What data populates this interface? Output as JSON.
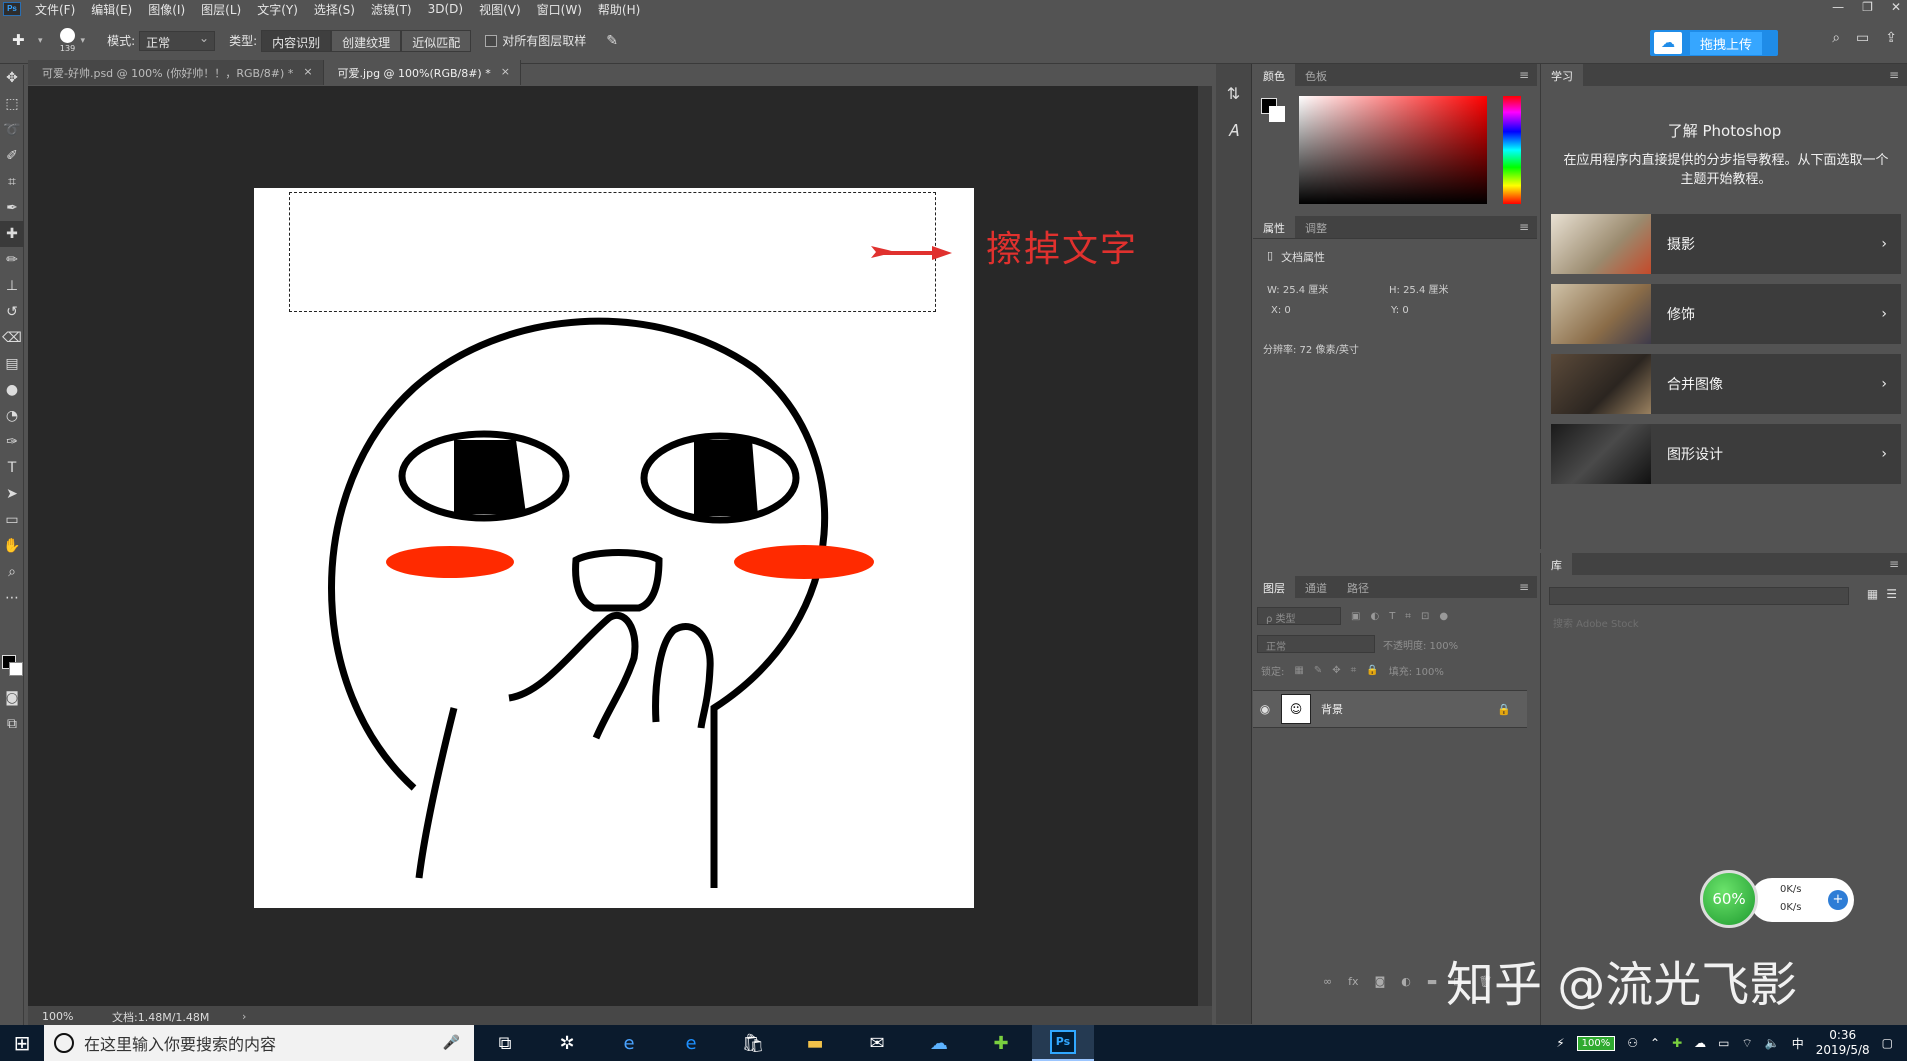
{
  "menubar": {
    "logo": "Ps",
    "items": [
      "文件(F)",
      "编辑(E)",
      "图像(I)",
      "图层(L)",
      "文字(Y)",
      "选择(S)",
      "滤镜(T)",
      "3D(D)",
      "视图(V)",
      "窗口(W)",
      "帮助(H)"
    ],
    "win_min": "—",
    "win_restore": "❐",
    "win_close": "✕"
  },
  "options": {
    "brush_size": "139",
    "mode_label": "模式:",
    "mode_value": "正常",
    "type_label": "类型:",
    "type_options": [
      "内容识别",
      "创建纹理",
      "近似匹配"
    ],
    "sample_all_label": "对所有图层取样",
    "upload_label": "拖拽上传"
  },
  "tabs": [
    {
      "label": "可爱-好帅.psd @ 100% (你好帅！！，RGB/8#) *"
    },
    {
      "label": "可爱.jpg @ 100%(RGB/8#) *"
    }
  ],
  "tab_close": "×",
  "canvas": {
    "annotation": "擦掉文字"
  },
  "status": {
    "zoom": "100%",
    "doc_size": "文档:1.48M/1.48M",
    "arrow": "›"
  },
  "color_panel": {
    "tabs": [
      "颜色",
      "色板"
    ],
    "colors": {
      "foreground": "#000000",
      "background": "#ffffff"
    }
  },
  "properties_panel": {
    "tabs": [
      "属性",
      "调整"
    ],
    "title": "文档属性",
    "w": "W:  25.4 厘米",
    "h": "H:  25.4 厘米",
    "x": "X:  0",
    "y": "Y:  0",
    "resolution": "分辨率: 72 像素/英寸"
  },
  "layers_panel": {
    "tabs": [
      "图层",
      "通道",
      "路径"
    ],
    "filter_placeholder": "ρ 类型",
    "blend_mode": "正常",
    "opacity": "不透明度: 100%",
    "lock_label": "锁定:",
    "fill": "填充: 100%",
    "layer_name": "背景"
  },
  "learn_panel": {
    "tab": "学习",
    "title": "了解 Photoshop",
    "description": "在应用程序内直接提供的分步指导教程。从下面选取一个主题开始教程。",
    "cards": [
      {
        "label": "摄影"
      },
      {
        "label": "修饰"
      },
      {
        "label": "合并图像"
      },
      {
        "label": "图形设计"
      }
    ]
  },
  "library_panel": {
    "tab": "库",
    "search_placeholder": "搜索 Adobe Stock"
  },
  "speed_widget": {
    "percent": "60%",
    "up": "0K/s",
    "down": "0K/s"
  },
  "watermark": "知乎 @流光飞影",
  "taskbar": {
    "search_placeholder": "在这里输入你要搜索的内容",
    "battery": "100%",
    "ime": "中",
    "time": "0:36",
    "date": "2019/5/8"
  }
}
